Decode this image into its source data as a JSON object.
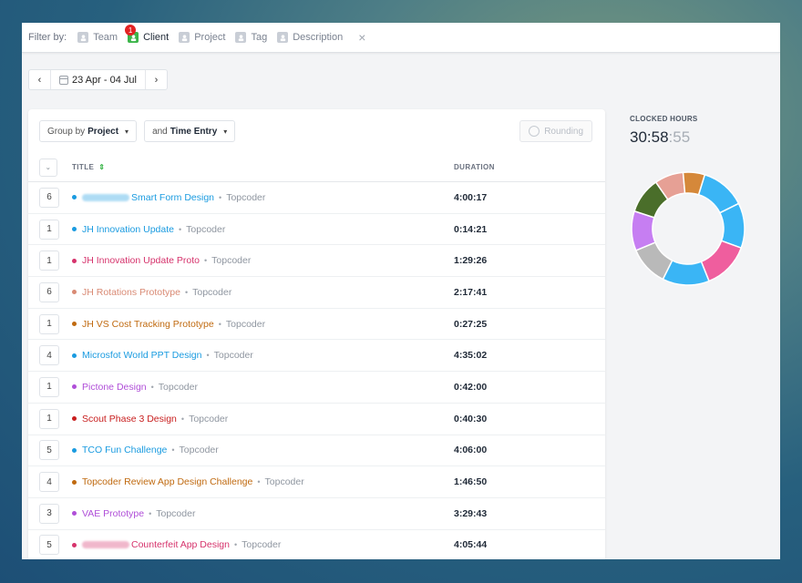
{
  "filter": {
    "label": "Filter by:",
    "items": [
      {
        "label": "Team",
        "active": false,
        "icon": "team-icon"
      },
      {
        "label": "Client",
        "active": true,
        "icon": "client-icon",
        "badge": "1"
      },
      {
        "label": "Project",
        "active": false,
        "icon": "project-icon"
      },
      {
        "label": "Tag",
        "active": false,
        "icon": "tag-icon"
      },
      {
        "label": "Description",
        "active": false,
        "icon": "description-icon"
      }
    ],
    "close": "×"
  },
  "date": {
    "prev": "‹",
    "range": "23 Apr - 04 Jul",
    "next": "›"
  },
  "controls": {
    "group_prefix": "Group by",
    "group_value": "Project",
    "then_prefix": "and",
    "then_value": "Time Entry",
    "rounding": "Rounding"
  },
  "table": {
    "col_title": "TITLE",
    "col_duration": "DURATION",
    "rows": [
      {
        "count": "6",
        "title": "Smart Form Design",
        "client": "Topcoder",
        "duration": "4:00:17",
        "color": "#1a9be0",
        "redacted": true
      },
      {
        "count": "1",
        "title": "JH Innovation Update",
        "client": "Topcoder",
        "duration": "0:14:21",
        "color": "#1a9be0",
        "redacted": false
      },
      {
        "count": "1",
        "title": "JH Innovation Update Proto",
        "client": "Topcoder",
        "duration": "1:29:26",
        "color": "#d6336c",
        "redacted": false
      },
      {
        "count": "6",
        "title": "JH Rotations Prototype",
        "client": "Topcoder",
        "duration": "2:17:41",
        "color": "#d98a74",
        "redacted": false
      },
      {
        "count": "1",
        "title": "JH VS Cost Tracking Prototype",
        "client": "Topcoder",
        "duration": "0:27:25",
        "color": "#c06a10",
        "redacted": false
      },
      {
        "count": "4",
        "title": "Microsfot World PPT Design",
        "client": "Topcoder",
        "duration": "4:35:02",
        "color": "#1a9be0",
        "redacted": false
      },
      {
        "count": "1",
        "title": "Pictone Design",
        "client": "Topcoder",
        "duration": "0:42:00",
        "color": "#b04fd8",
        "redacted": false
      },
      {
        "count": "1",
        "title": "Scout Phase 3 Design",
        "client": "Topcoder",
        "duration": "0:40:30",
        "color": "#c81e1e",
        "redacted": false
      },
      {
        "count": "5",
        "title": "TCO Fun Challenge",
        "client": "Topcoder",
        "duration": "4:06:00",
        "color": "#1a9be0",
        "redacted": false
      },
      {
        "count": "4",
        "title": "Topcoder Review App Design Challenge",
        "client": "Topcoder",
        "duration": "1:46:50",
        "color": "#c06a10",
        "redacted": false
      },
      {
        "count": "3",
        "title": "VAE Prototype",
        "client": "Topcoder",
        "duration": "3:29:43",
        "color": "#b04fd8",
        "redacted": false
      },
      {
        "count": "5",
        "title": "Counterfeit App Design",
        "client": "Topcoder",
        "duration": "4:05:44",
        "color": "#d6336c",
        "redacted": true
      }
    ]
  },
  "summary": {
    "label": "CLOCKED HOURS",
    "value_main": "30:58",
    "value_sec": ":55"
  },
  "chart_data": {
    "type": "pie",
    "series": [
      {
        "color": "#3ab5f5",
        "value": 12.5
      },
      {
        "color": "#3ab5f5",
        "value": 12.5
      },
      {
        "color": "#ef5e9e",
        "value": 13
      },
      {
        "color": "#3ab5f5",
        "value": 13
      },
      {
        "color": "#b9b9b9",
        "value": 11
      },
      {
        "color": "#c67ef2",
        "value": 11
      },
      {
        "color": "#4a6e2a",
        "value": 10
      },
      {
        "color": "#e6a095",
        "value": 8
      },
      {
        "color": "#d5883a",
        "value": 6
      }
    ]
  }
}
